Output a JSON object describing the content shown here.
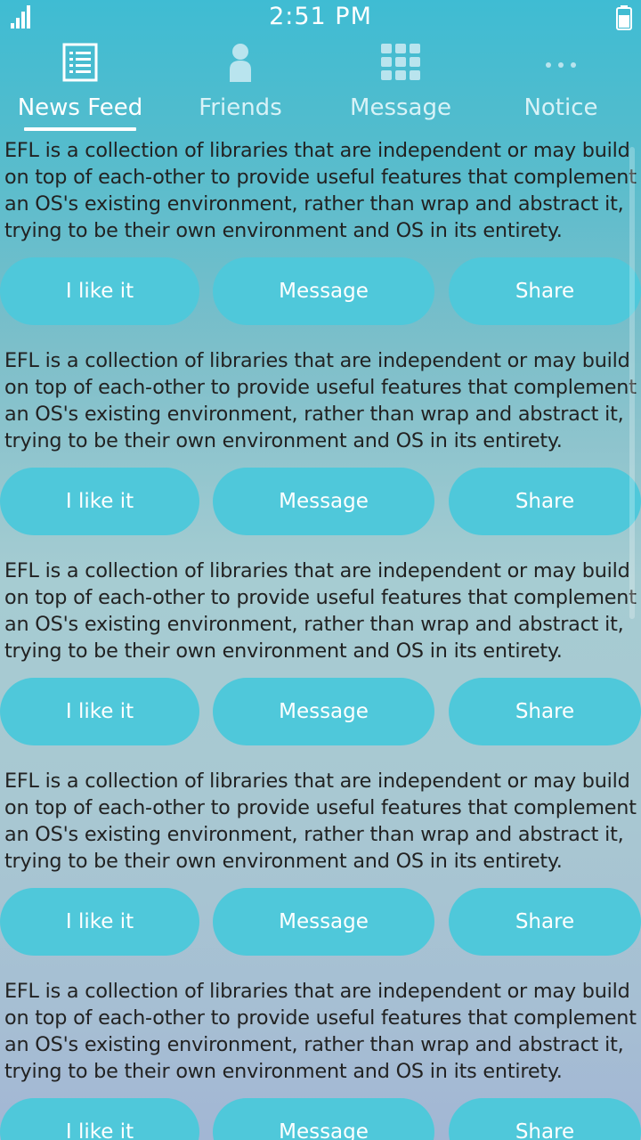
{
  "status_bar": {
    "time": "2:51 PM",
    "signal_icon": "signal-bars-icon",
    "battery_icon": "battery-icon"
  },
  "tabs": [
    {
      "label": "News Feed",
      "icon": "news-feed-icon",
      "active": true
    },
    {
      "label": "Friends",
      "icon": "person-icon",
      "active": false
    },
    {
      "label": "Message",
      "icon": "grid-icon",
      "active": false
    },
    {
      "label": "Notice",
      "icon": "more-dots-icon",
      "active": false
    }
  ],
  "posts": [
    {
      "text": "EFL is a collection of libraries that are independent or may build\non top of each-other to provide useful features that complement\nan OS's existing environment, rather than wrap and abstract it,\ntrying to be their own environment and OS in its entirety.",
      "like_label": "I like it",
      "message_label": "Message",
      "share_label": "Share"
    },
    {
      "text": "EFL is a collection of libraries that are independent or may build\non top of each-other to provide useful features that complement\nan OS's existing environment, rather than wrap and abstract it,\ntrying to be their own environment and OS in its entirety.",
      "like_label": "I like it",
      "message_label": "Message",
      "share_label": "Share"
    },
    {
      "text": "EFL is a collection of libraries that are independent or may build\non top of each-other to provide useful features that complement\nan OS's existing environment, rather than wrap and abstract it,\ntrying to be their own environment and OS in its entirety.",
      "like_label": "I like it",
      "message_label": "Message",
      "share_label": "Share"
    },
    {
      "text": "EFL is a collection of libraries that are independent or may build\non top of each-other to provide useful features that complement\nan OS's existing environment, rather than wrap and abstract it,\ntrying to be their own environment and OS in its entirety.",
      "like_label": "I like it",
      "message_label": "Message",
      "share_label": "Share"
    },
    {
      "text": "EFL is a collection of libraries that are independent or may build\non top of each-other to provide useful features that complement\nan OS's existing environment, rather than wrap and abstract it,\ntrying to be their own environment and OS in its entirety.",
      "like_label": "I like it",
      "message_label": "Message",
      "share_label": "Share"
    }
  ],
  "colors": {
    "button_bg": "#4fc8da",
    "header_bg": "#3fbcd3",
    "text": "#222222"
  }
}
